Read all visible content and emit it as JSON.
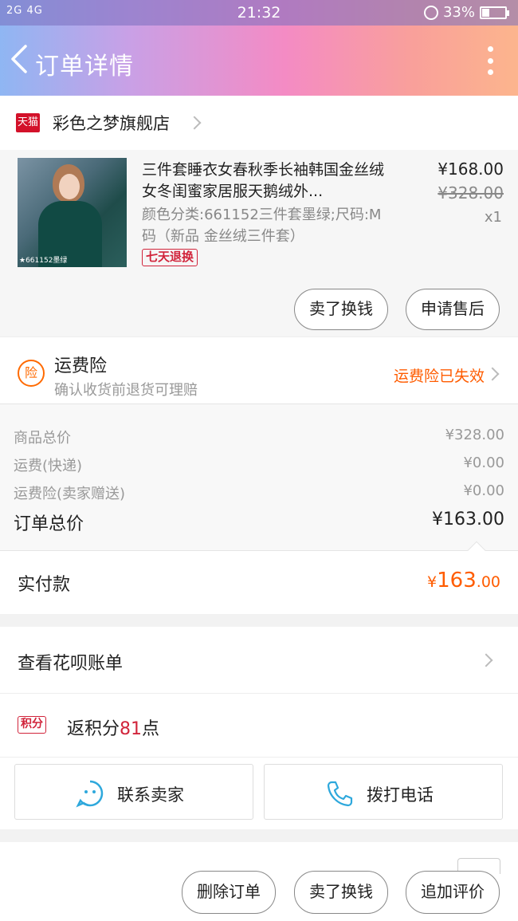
{
  "status_bar": {
    "network": "2G 4G",
    "time": "21:32",
    "battery": "33%",
    "battery_level": 0.33,
    "more": "···"
  },
  "header": {
    "title": "订单详情",
    "back_icon": "chevron-left-icon",
    "more_icon": "more-vertical-icon"
  },
  "store": {
    "badge": "天猫",
    "name": "彩色之梦旗舰店"
  },
  "product": {
    "name": "三件套睡衣女春秋季长袖韩国金丝绒女冬闺蜜家居服天鹅绒外...",
    "spec": "颜色分类:661152三件套墨绿;尺码:M码（新品 金丝绒三件套）",
    "badge": "七天退换",
    "image_tag": "★661152墨绿",
    "price": "¥168.00",
    "original_price": "¥328.00",
    "quantity": "x1",
    "sell_button": "卖了换钱",
    "aftersale_button": "申请售后"
  },
  "insurance": {
    "icon_text": "险",
    "title": "运费险",
    "subtitle": "确认收货前退货可理赔",
    "status": "运费险已失效"
  },
  "totals": {
    "rows": [
      {
        "label": "商品总价",
        "value": "¥328.00"
      },
      {
        "label": "运费(快递)",
        "value": "¥0.00"
      },
      {
        "label": "运费险(卖家赠送)",
        "value": "¥0.00"
      }
    ],
    "order_total_label": "订单总价",
    "order_total_value": "¥163.00"
  },
  "paid": {
    "label": "实付款",
    "currency": "¥",
    "amount_int": "163",
    "amount_dec": ".00"
  },
  "huabei": {
    "label": "查看花呗账单"
  },
  "points": {
    "badge": "积分",
    "prefix": "返积分",
    "number": "81",
    "suffix": "点"
  },
  "contact": {
    "seller": "联系卖家",
    "phone": "拨打电话"
  },
  "bottom": {
    "delete": "删除订单",
    "sell": "卖了换钱",
    "review": "追加评价"
  },
  "colors": {
    "accent_orange": "#ff5c00",
    "tmall_red": "#d3112a",
    "chat_blue": "#2ea8dc"
  }
}
